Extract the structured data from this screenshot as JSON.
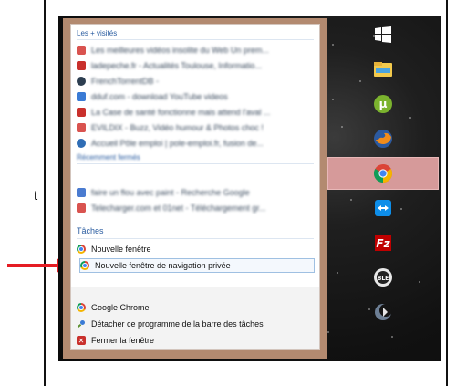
{
  "side_text": "t",
  "jumplist": {
    "frequent_header": "Les + visités",
    "frequent_items": [
      {
        "label": "Les meilleures vidéos insolite du Web Un prem...",
        "icon": "red-video-icon",
        "color": "#d9534f"
      },
      {
        "label": "ladepeche.fr - Actualités Toulouse, Informatio...",
        "icon": "red-d-icon",
        "color": "#c9302c"
      },
      {
        "label": "FrenchTorrentDB -",
        "icon": "dark-globe-icon",
        "color": "#2d3e50"
      },
      {
        "label": "dduf.com - download YouTube videos",
        "icon": "blue-arrow-icon",
        "color": "#3a7bd5"
      },
      {
        "label": "La Case de santé fonctionne mais attend l'aval ...",
        "icon": "red-d-icon",
        "color": "#c9302c"
      },
      {
        "label": "EVILDIX - Buzz, Vidéo humour & Photos choc !",
        "icon": "red-x-icon",
        "color": "#d9534f"
      },
      {
        "label": "Accueil Pôle emploi | pole-emploi.fr, fusion de...",
        "icon": "blue-globe-icon",
        "color": "#2f6db5"
      }
    ],
    "recent_header": "Récemment fermés",
    "recent_items": [
      {
        "label": "faire un flou avec paint - Recherche Google",
        "icon": "google-square-icon",
        "color": "#4a7bd0"
      },
      {
        "label": "Telecharger.com et 01net - Téléchargement gr...",
        "icon": "red-square-icon",
        "color": "#d9534f"
      }
    ],
    "tasks_header": "Tâches",
    "tasks": [
      {
        "label": "Nouvelle fenêtre"
      },
      {
        "label": "Nouvelle fenêtre de navigation privée"
      }
    ],
    "bottom": {
      "app_label": "Google Chrome",
      "unpin_label": "Détacher ce programme de la barre des tâches",
      "close_label": "Fermer la fenêtre"
    }
  },
  "taskbar": {
    "items": [
      {
        "name": "start-windows-icon",
        "active": false
      },
      {
        "name": "file-explorer-icon",
        "active": false
      },
      {
        "name": "utorrent-icon",
        "active": false
      },
      {
        "name": "firefox-icon",
        "active": false
      },
      {
        "name": "chrome-icon",
        "active": true
      },
      {
        "name": "teamviewer-icon",
        "active": false
      },
      {
        "name": "filezilla-icon",
        "active": false
      },
      {
        "name": "ble-app-icon",
        "active": false
      },
      {
        "name": "moon-app-icon",
        "active": false
      }
    ]
  },
  "colors": {
    "menu_border": "#b38a70",
    "header_blue": "#2b5da1",
    "active_taskbar": "#d69a9a",
    "arrow_red": "#e51c23"
  }
}
